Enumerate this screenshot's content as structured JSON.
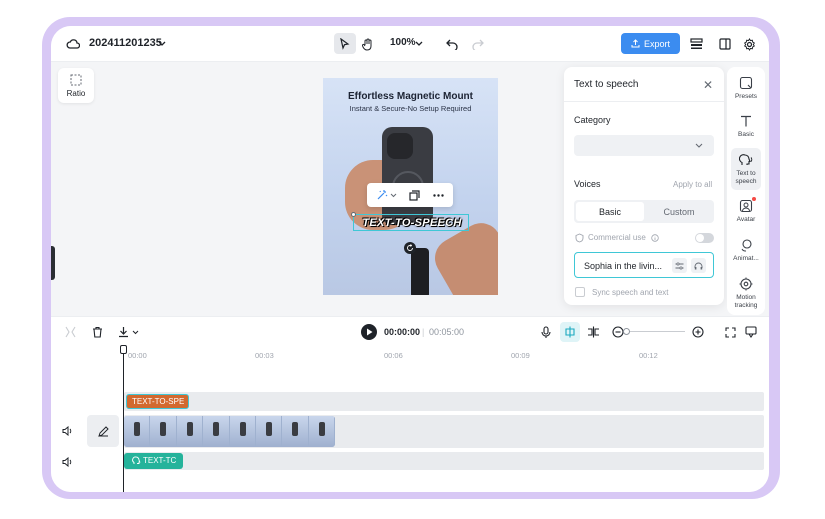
{
  "app": {
    "project_name": "202411201235",
    "zoom_level": "100%",
    "export_label": "Export"
  },
  "canvas": {
    "ratio_label": "Ratio",
    "video_title": "Effortless Magnetic Mount",
    "video_subtitle": "Instant & Secure-No Setup Required",
    "overlay_text": "TEXT-TO-SPEECH"
  },
  "tts_panel": {
    "title": "Text to speech",
    "category_label": "Category",
    "category_value": "",
    "voices_label": "Voices",
    "apply_all": "Apply to all",
    "tabs": [
      "Basic",
      "Custom"
    ],
    "active_tab": "Basic",
    "commercial_use": "Commercial use",
    "commercial_use_enabled": false,
    "selected_voice": "Sophia in the livin...",
    "sync_label": "Sync speech and text",
    "sync_checked": false
  },
  "rail": {
    "items": [
      {
        "label": "Presets",
        "icon": "presets-icon"
      },
      {
        "label": "Basic",
        "icon": "text-icon"
      },
      {
        "label": "Text to speech",
        "icon": "speech-head-icon",
        "active": true
      },
      {
        "label": "Avatar",
        "icon": "avatar-icon",
        "badge": true
      },
      {
        "label": "Animat...",
        "icon": "animation-icon"
      },
      {
        "label": "Motion tracking",
        "icon": "target-icon"
      }
    ]
  },
  "timeline": {
    "current_time": "00:00:00",
    "total_time": "00:05:00",
    "ruler_ticks": [
      "00:00",
      "00:03",
      "00:06",
      "00:09",
      "00:12"
    ],
    "text_clip_label": "TEXT-TO-SPE",
    "audio_clip_label": "TEXT-TC",
    "video_frame_count": 8,
    "accent_color": "#3fc7d6"
  }
}
